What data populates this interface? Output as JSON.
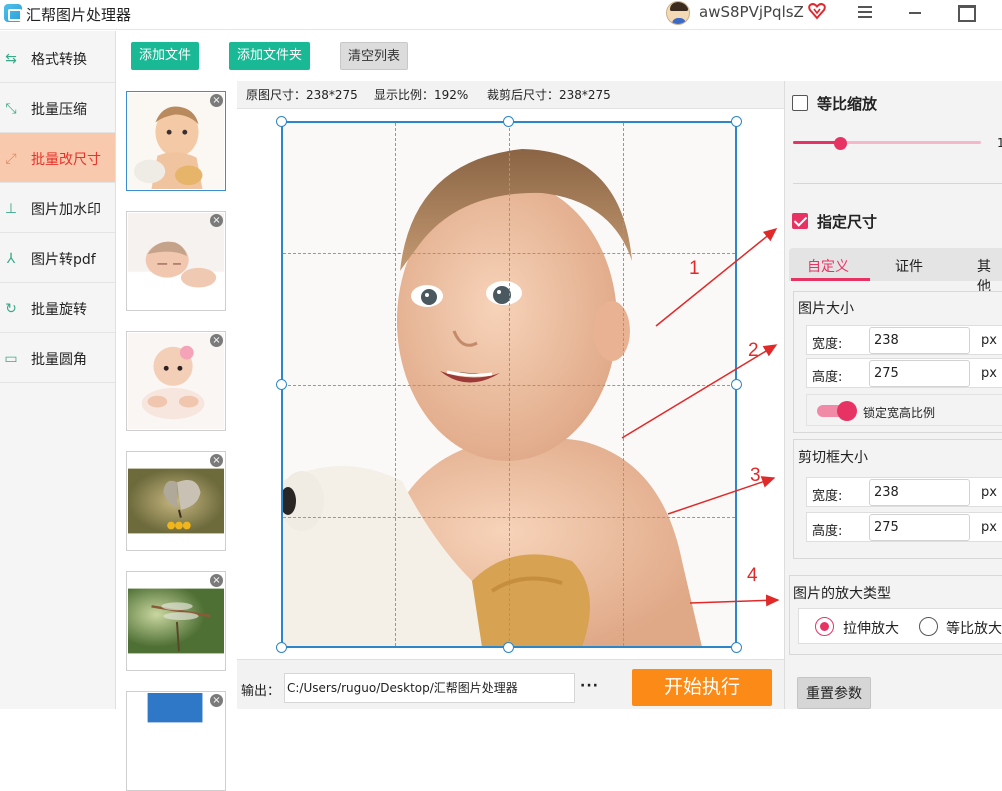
{
  "app": {
    "title": "汇帮图片处理器",
    "username": "awS8PVjPqlsZ"
  },
  "sidebar": {
    "items": [
      {
        "label": "格式转换",
        "icon": "format-convert-icon",
        "active": false
      },
      {
        "label": "批量压缩",
        "icon": "compress-icon",
        "active": false
      },
      {
        "label": "批量改尺寸",
        "icon": "resize-icon",
        "active": true
      },
      {
        "label": "图片加水印",
        "icon": "watermark-icon",
        "active": false
      },
      {
        "label": "图片转pdf",
        "icon": "pdf-icon",
        "active": false
      },
      {
        "label": "批量旋转",
        "icon": "rotate-icon",
        "active": false
      },
      {
        "label": "批量圆角",
        "icon": "rounded-corner-icon",
        "active": false
      }
    ]
  },
  "toolbar": {
    "add_file": "添加文件",
    "add_folder": "添加文件夹",
    "clear_list": "清空列表"
  },
  "thumbnails": {
    "close_glyph": "×",
    "items": [
      {
        "subject": "baby",
        "selected": true
      },
      {
        "subject": "sleeping-baby",
        "selected": false
      },
      {
        "subject": "baby-on-blanket",
        "selected": false
      },
      {
        "subject": "butterfly",
        "selected": false
      },
      {
        "subject": "dragonfly",
        "selected": false
      },
      {
        "subject": "sky",
        "selected": false
      }
    ]
  },
  "info": {
    "original_size": "原图尺寸：238*275",
    "display_ratio": "显示比例：192%",
    "cropped_size": "裁剪后尺寸：238*275"
  },
  "output": {
    "label": "输出：",
    "path": "C:/Users/ruguo/Desktop/汇帮图片处理器",
    "more": "···",
    "start": "开始执行"
  },
  "right_panel": {
    "proportional_scale": {
      "label": "等比缩放",
      "checked": false,
      "slider_value": 0.25,
      "slider_text": "1"
    },
    "specify_size": {
      "label": "指定尺寸",
      "checked": true
    },
    "tabs": [
      {
        "label": "自定义",
        "active": true
      },
      {
        "label": "证件",
        "active": false
      },
      {
        "label": "其他",
        "active": false
      }
    ],
    "image_size": {
      "title": "图片大小",
      "width_label": "宽度:",
      "width_value": "238",
      "height_label": "高度:",
      "height_value": "275",
      "unit": "px",
      "lock_label": "锁定宽高比例",
      "lock_on": true
    },
    "crop_size": {
      "title": "剪切框大小",
      "width_label": "宽度:",
      "width_value": "238",
      "height_label": "高度:",
      "height_value": "275",
      "unit": "px"
    },
    "enlarge_type": {
      "title": "图片的放大类型",
      "options": [
        {
          "label": "拉伸放大",
          "checked": true
        },
        {
          "label": "等比放大",
          "checked": false
        }
      ]
    },
    "reset": "重置参数"
  },
  "annotations": [
    "1",
    "2",
    "3",
    "4"
  ],
  "colors": {
    "accent": "#e73363",
    "primary_green": "#19b995",
    "start_orange": "#fb8a17",
    "arrow_red": "#e02a2a",
    "active_side": "#f9c9ad"
  }
}
